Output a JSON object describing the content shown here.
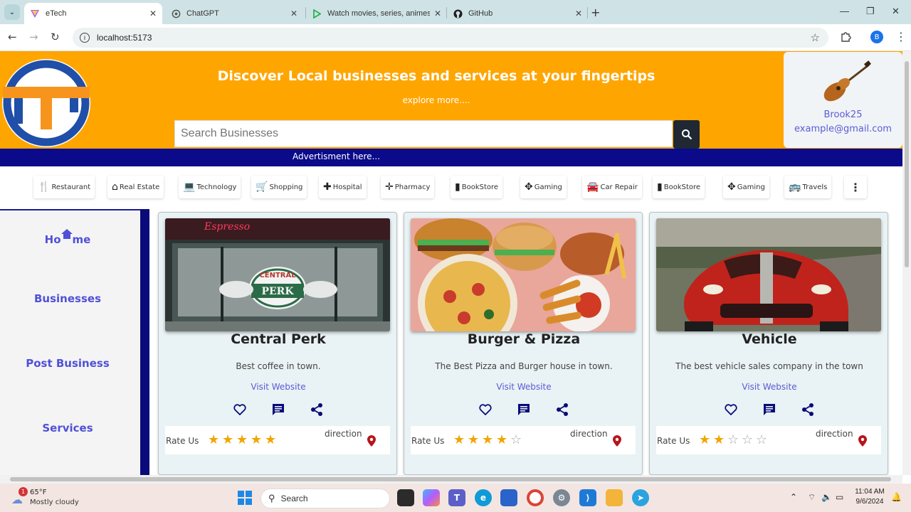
{
  "browser": {
    "tabs": [
      {
        "title": "eTech",
        "active": true
      },
      {
        "title": "ChatGPT",
        "active": false
      },
      {
        "title": "Watch movies, series, animes on",
        "active": false
      },
      {
        "title": "GitHub",
        "active": false
      }
    ],
    "url": "localhost:5173",
    "profile_initial": "B"
  },
  "header": {
    "headline": "Discover Local businesses and services at your fingertips",
    "explore": "explore more....",
    "search_placeholder": "Search Businesses",
    "brand_color": "#ffa500"
  },
  "profile": {
    "username": "Brook25",
    "email": "example@gmail.com"
  },
  "ad_text": "Advertisment here...",
  "categories": [
    {
      "label": "Restaurant",
      "icon": "utensils-icon"
    },
    {
      "label": "Real Estate",
      "icon": "house-icon"
    },
    {
      "label": "Technology",
      "icon": "laptop-icon"
    },
    {
      "label": "Shopping",
      "icon": "cart-icon"
    },
    {
      "label": "Hospital",
      "icon": "hospital-icon"
    },
    {
      "label": "Pharmacy",
      "icon": "pharmacy-icon"
    },
    {
      "label": "BookStore",
      "icon": "book-icon"
    },
    {
      "label": "Gaming",
      "icon": "gamepad-icon"
    },
    {
      "label": "Car Repair",
      "icon": "car-icon"
    },
    {
      "label": "BookStore",
      "icon": "book-icon"
    },
    {
      "label": "Gaming",
      "icon": "gamepad-icon"
    },
    {
      "label": "Travels",
      "icon": "bus-icon"
    }
  ],
  "sidebar": {
    "home_pre": "Ho",
    "home_post": "me",
    "items": [
      "Businesses",
      "Post Business",
      "Services"
    ]
  },
  "cards": [
    {
      "title": "Central Perk",
      "description": "Best coffee in town.",
      "link": "Visit Website",
      "rate_label": "Rate Us",
      "rating": 5,
      "direction": "direction",
      "image": "cafe-photo"
    },
    {
      "title": "Burger & Pizza",
      "description": "The Best Pizza and Burger house in town.",
      "link": "Visit Website",
      "rate_label": "Rate Us",
      "rating": 4,
      "direction": "direction",
      "image": "food-photo"
    },
    {
      "title": "Vehicle",
      "description": "The best vehicle sales company in the town",
      "link": "Visit Website",
      "rate_label": "Rate Us",
      "rating": 2,
      "direction": "direction",
      "image": "car-photo"
    }
  ],
  "taskbar": {
    "weather_temp": "65°F",
    "weather_desc": "Mostly cloudy",
    "weather_badge": "1",
    "search": "Search",
    "time": "11:04 AM",
    "date": "9/6/2024"
  }
}
